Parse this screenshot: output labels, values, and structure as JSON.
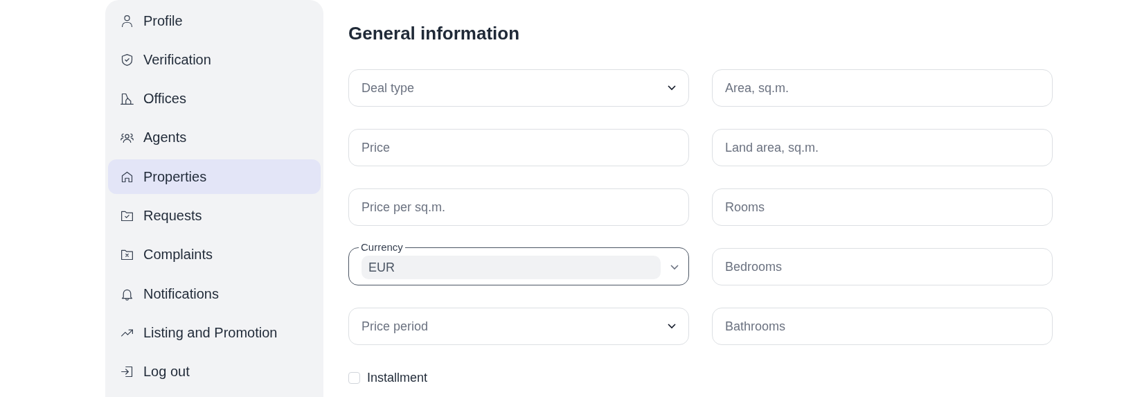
{
  "sidebar": {
    "items": [
      {
        "label": "Profile",
        "selected": false
      },
      {
        "label": "Verification",
        "selected": false
      },
      {
        "label": "Offices",
        "selected": false
      },
      {
        "label": "Agents",
        "selected": false
      },
      {
        "label": "Properties",
        "selected": true
      },
      {
        "label": "Requests",
        "selected": false
      },
      {
        "label": "Complaints",
        "selected": false
      },
      {
        "label": "Notifications",
        "selected": false
      },
      {
        "label": "Listing and Promotion",
        "selected": false
      },
      {
        "label": "Log out",
        "selected": false
      }
    ]
  },
  "form": {
    "title": "General information",
    "fields": [
      {
        "kind": "select",
        "placeholder": "Deal type"
      },
      {
        "kind": "input",
        "placeholder": "Area, sq.m."
      },
      {
        "kind": "input",
        "placeholder": "Price"
      },
      {
        "kind": "input",
        "placeholder": "Land area, sq.m."
      },
      {
        "kind": "input",
        "placeholder": "Price per sq.m."
      },
      {
        "kind": "input",
        "placeholder": "Rooms"
      },
      {
        "kind": "select",
        "label": "Currency",
        "value": "EUR"
      },
      {
        "kind": "input",
        "placeholder": "Bedrooms"
      },
      {
        "kind": "select",
        "placeholder": "Price period"
      },
      {
        "kind": "input",
        "placeholder": "Bathrooms"
      }
    ],
    "installment": {
      "label": "Installment",
      "checked": false
    }
  }
}
